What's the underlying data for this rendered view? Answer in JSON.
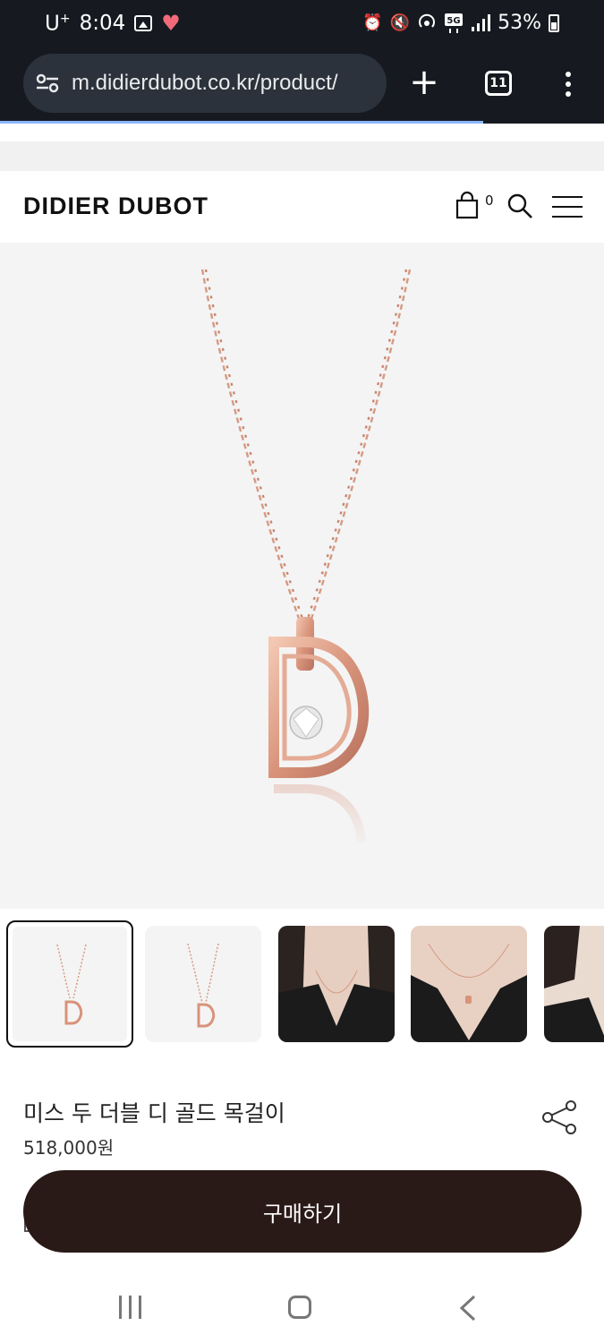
{
  "status_bar": {
    "carrier": "U",
    "carrier_sup": "+",
    "time": "8:04",
    "battery": "53%"
  },
  "browser": {
    "url": "m.didierdubot.co.kr/product/",
    "tab_count": "11"
  },
  "header": {
    "logo": "DIDIER DUBOT",
    "cart_count": "0"
  },
  "product": {
    "name": "미스 두 더블 디 골드 목걸이",
    "price": "518,000원",
    "buy_label": "구매하기"
  },
  "thumbnails": [
    {
      "kind": "pendant",
      "selected": true
    },
    {
      "kind": "pendant",
      "selected": false
    },
    {
      "kind": "model",
      "selected": false
    },
    {
      "kind": "model",
      "selected": false
    },
    {
      "kind": "model-side",
      "selected": false
    }
  ],
  "colors": {
    "browser_chrome": "#161a20",
    "accent_progress": "#8ab4f8",
    "buy_button": "#2a1a17",
    "gold": "#d89a83",
    "heart": "#f06a7a"
  }
}
